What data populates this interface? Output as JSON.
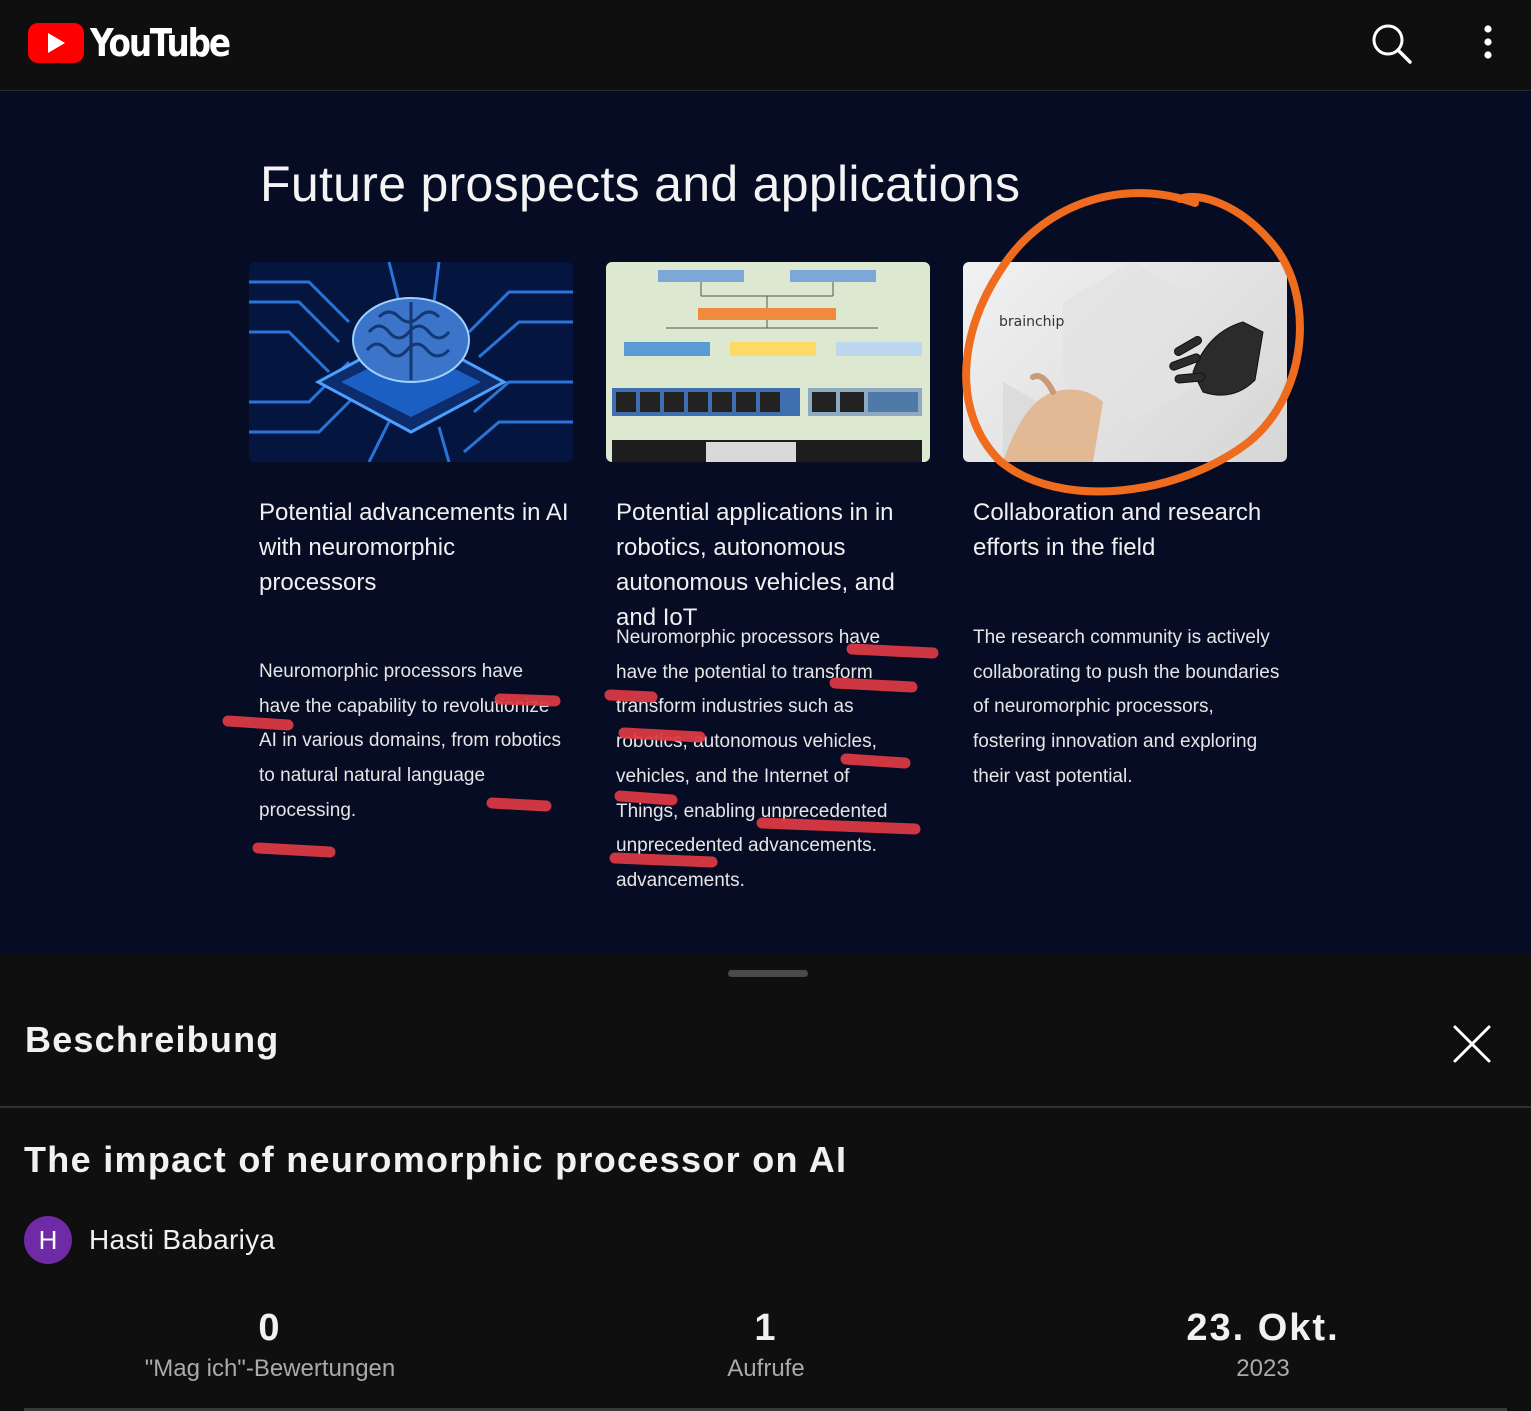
{
  "app": {
    "logo_text": "YouTube",
    "brand_color": "#ff0000",
    "search_icon": "search-icon",
    "more_icon": "more-vert-icon"
  },
  "slide": {
    "title": "Future prospects and applications",
    "annotation_colors": {
      "circle": "#ef6b1e",
      "scribble": "#e03a44"
    },
    "columns": [
      {
        "heading": "Potential advancements in AI with neuromorphic processors",
        "body": "Neuromorphic processors have have the capability to revolutionize AI in various domains, from robotics to natural natural language processing."
      },
      {
        "heading": "Potential applications in in robotics, autonomous autonomous vehicles, and and IoT",
        "body": "Neuromorphic processors have have the potential to transform transform industries such as robotics, autonomous vehicles, vehicles, and the Internet of Things, enabling unprecedented unprecedented advancements. advancements."
      },
      {
        "heading": "Collaboration and research efforts in the field",
        "body": "The research community is actively collaborating to push the boundaries of neuromorphic processors, fostering innovation and exploring their vast potential."
      }
    ],
    "thumb3_brand": "brainchip"
  },
  "description": {
    "header": "Beschreibung",
    "close_icon": "close-icon",
    "video_title": "The impact of neuromorphic processor on AI",
    "channel": {
      "avatar_letter": "H",
      "avatar_color": "#6f2aa6",
      "name": "Hasti Babariya"
    },
    "stats": [
      {
        "value": "0",
        "label": "\"Mag ich\"-Bewertungen"
      },
      {
        "value": "1",
        "label": "Aufrufe"
      },
      {
        "value": "23. Okt.",
        "label": "2023"
      }
    ]
  }
}
